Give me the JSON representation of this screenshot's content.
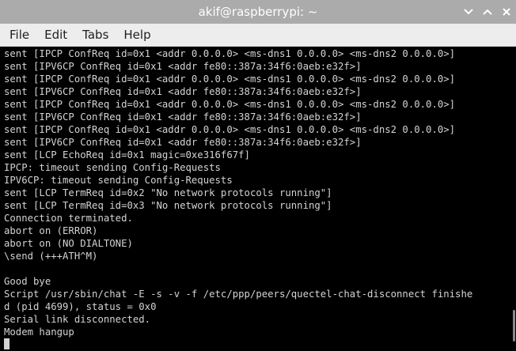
{
  "window": {
    "title": "akif@raspberrypi: ~",
    "colors": {
      "titlebar": "#ababab",
      "menubar": "#ededed",
      "terminal_bg": "#000000",
      "terminal_fg": "#d3d3d3"
    },
    "controls": [
      "minimize-icon",
      "maximize-icon",
      "close-icon"
    ]
  },
  "menu": {
    "items": [
      {
        "label": "File"
      },
      {
        "label": "Edit"
      },
      {
        "label": "Tabs"
      },
      {
        "label": "Help"
      }
    ]
  },
  "terminal": {
    "lines": [
      "sent [IPCP ConfReq id=0x1 <addr 0.0.0.0> <ms-dns1 0.0.0.0> <ms-dns2 0.0.0.0>]",
      "sent [IPV6CP ConfReq id=0x1 <addr fe80::387a:34f6:0aeb:e32f>]",
      "sent [IPCP ConfReq id=0x1 <addr 0.0.0.0> <ms-dns1 0.0.0.0> <ms-dns2 0.0.0.0>]",
      "sent [IPV6CP ConfReq id=0x1 <addr fe80::387a:34f6:0aeb:e32f>]",
      "sent [IPCP ConfReq id=0x1 <addr 0.0.0.0> <ms-dns1 0.0.0.0> <ms-dns2 0.0.0.0>]",
      "sent [IPV6CP ConfReq id=0x1 <addr fe80::387a:34f6:0aeb:e32f>]",
      "sent [IPCP ConfReq id=0x1 <addr 0.0.0.0> <ms-dns1 0.0.0.0> <ms-dns2 0.0.0.0>]",
      "sent [IPV6CP ConfReq id=0x1 <addr fe80::387a:34f6:0aeb:e32f>]",
      "sent [LCP EchoReq id=0x1 magic=0xe316f67f]",
      "IPCP: timeout sending Config-Requests",
      "IPV6CP: timeout sending Config-Requests",
      "sent [LCP TermReq id=0x2 \"No network protocols running\"]",
      "sent [LCP TermReq id=0x3 \"No network protocols running\"]",
      "Connection terminated.",
      "abort on (ERROR)",
      "abort on (NO DIALTONE)",
      "\\send (+++ATH^M)",
      "",
      "Good bye",
      "Script /usr/sbin/chat -E -s -v -f /etc/ppp/peers/quectel-chat-disconnect finishe",
      "d (pid 4699), status = 0x0",
      "Serial link disconnected.",
      "Modem hangup"
    ]
  }
}
